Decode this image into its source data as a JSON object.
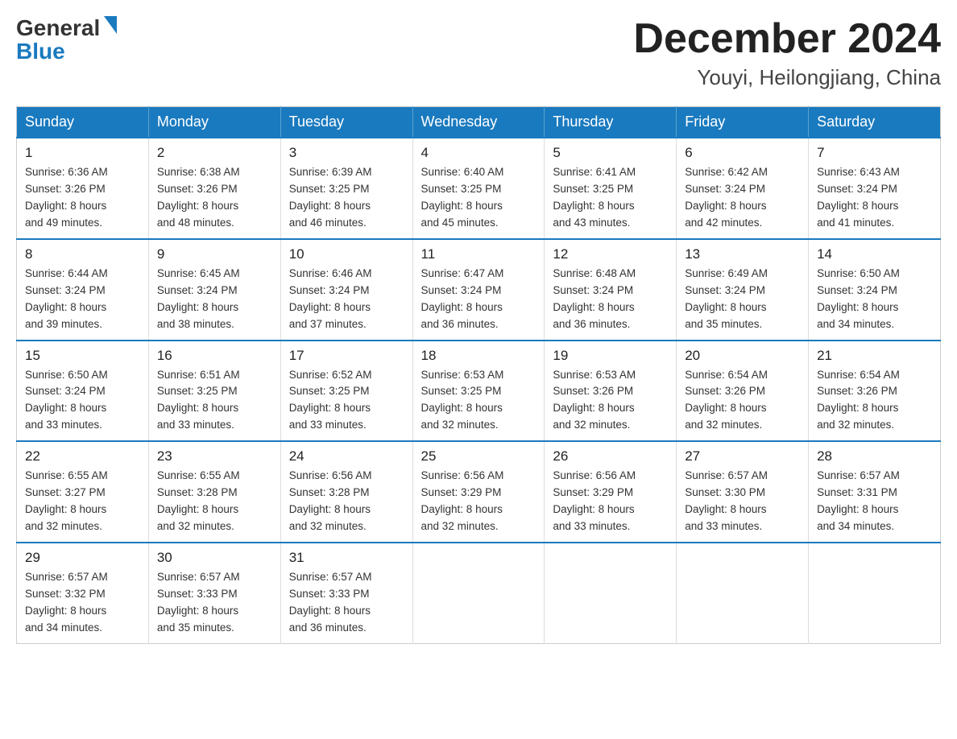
{
  "header": {
    "logo_general": "General",
    "logo_blue": "Blue",
    "month_title": "December 2024",
    "location": "Youyi, Heilongjiang, China"
  },
  "weekdays": [
    "Sunday",
    "Monday",
    "Tuesday",
    "Wednesday",
    "Thursday",
    "Friday",
    "Saturday"
  ],
  "weeks": [
    [
      {
        "day": "1",
        "sunrise": "6:36 AM",
        "sunset": "3:26 PM",
        "daylight": "8 hours and 49 minutes."
      },
      {
        "day": "2",
        "sunrise": "6:38 AM",
        "sunset": "3:26 PM",
        "daylight": "8 hours and 48 minutes."
      },
      {
        "day": "3",
        "sunrise": "6:39 AM",
        "sunset": "3:25 PM",
        "daylight": "8 hours and 46 minutes."
      },
      {
        "day": "4",
        "sunrise": "6:40 AM",
        "sunset": "3:25 PM",
        "daylight": "8 hours and 45 minutes."
      },
      {
        "day": "5",
        "sunrise": "6:41 AM",
        "sunset": "3:25 PM",
        "daylight": "8 hours and 43 minutes."
      },
      {
        "day": "6",
        "sunrise": "6:42 AM",
        "sunset": "3:24 PM",
        "daylight": "8 hours and 42 minutes."
      },
      {
        "day": "7",
        "sunrise": "6:43 AM",
        "sunset": "3:24 PM",
        "daylight": "8 hours and 41 minutes."
      }
    ],
    [
      {
        "day": "8",
        "sunrise": "6:44 AM",
        "sunset": "3:24 PM",
        "daylight": "8 hours and 39 minutes."
      },
      {
        "day": "9",
        "sunrise": "6:45 AM",
        "sunset": "3:24 PM",
        "daylight": "8 hours and 38 minutes."
      },
      {
        "day": "10",
        "sunrise": "6:46 AM",
        "sunset": "3:24 PM",
        "daylight": "8 hours and 37 minutes."
      },
      {
        "day": "11",
        "sunrise": "6:47 AM",
        "sunset": "3:24 PM",
        "daylight": "8 hours and 36 minutes."
      },
      {
        "day": "12",
        "sunrise": "6:48 AM",
        "sunset": "3:24 PM",
        "daylight": "8 hours and 36 minutes."
      },
      {
        "day": "13",
        "sunrise": "6:49 AM",
        "sunset": "3:24 PM",
        "daylight": "8 hours and 35 minutes."
      },
      {
        "day": "14",
        "sunrise": "6:50 AM",
        "sunset": "3:24 PM",
        "daylight": "8 hours and 34 minutes."
      }
    ],
    [
      {
        "day": "15",
        "sunrise": "6:50 AM",
        "sunset": "3:24 PM",
        "daylight": "8 hours and 33 minutes."
      },
      {
        "day": "16",
        "sunrise": "6:51 AM",
        "sunset": "3:25 PM",
        "daylight": "8 hours and 33 minutes."
      },
      {
        "day": "17",
        "sunrise": "6:52 AM",
        "sunset": "3:25 PM",
        "daylight": "8 hours and 33 minutes."
      },
      {
        "day": "18",
        "sunrise": "6:53 AM",
        "sunset": "3:25 PM",
        "daylight": "8 hours and 32 minutes."
      },
      {
        "day": "19",
        "sunrise": "6:53 AM",
        "sunset": "3:26 PM",
        "daylight": "8 hours and 32 minutes."
      },
      {
        "day": "20",
        "sunrise": "6:54 AM",
        "sunset": "3:26 PM",
        "daylight": "8 hours and 32 minutes."
      },
      {
        "day": "21",
        "sunrise": "6:54 AM",
        "sunset": "3:26 PM",
        "daylight": "8 hours and 32 minutes."
      }
    ],
    [
      {
        "day": "22",
        "sunrise": "6:55 AM",
        "sunset": "3:27 PM",
        "daylight": "8 hours and 32 minutes."
      },
      {
        "day": "23",
        "sunrise": "6:55 AM",
        "sunset": "3:28 PM",
        "daylight": "8 hours and 32 minutes."
      },
      {
        "day": "24",
        "sunrise": "6:56 AM",
        "sunset": "3:28 PM",
        "daylight": "8 hours and 32 minutes."
      },
      {
        "day": "25",
        "sunrise": "6:56 AM",
        "sunset": "3:29 PM",
        "daylight": "8 hours and 32 minutes."
      },
      {
        "day": "26",
        "sunrise": "6:56 AM",
        "sunset": "3:29 PM",
        "daylight": "8 hours and 33 minutes."
      },
      {
        "day": "27",
        "sunrise": "6:57 AM",
        "sunset": "3:30 PM",
        "daylight": "8 hours and 33 minutes."
      },
      {
        "day": "28",
        "sunrise": "6:57 AM",
        "sunset": "3:31 PM",
        "daylight": "8 hours and 34 minutes."
      }
    ],
    [
      {
        "day": "29",
        "sunrise": "6:57 AM",
        "sunset": "3:32 PM",
        "daylight": "8 hours and 34 minutes."
      },
      {
        "day": "30",
        "sunrise": "6:57 AM",
        "sunset": "3:33 PM",
        "daylight": "8 hours and 35 minutes."
      },
      {
        "day": "31",
        "sunrise": "6:57 AM",
        "sunset": "3:33 PM",
        "daylight": "8 hours and 36 minutes."
      },
      null,
      null,
      null,
      null
    ]
  ],
  "labels": {
    "sunrise": "Sunrise: ",
    "sunset": "Sunset: ",
    "daylight": "Daylight: "
  }
}
